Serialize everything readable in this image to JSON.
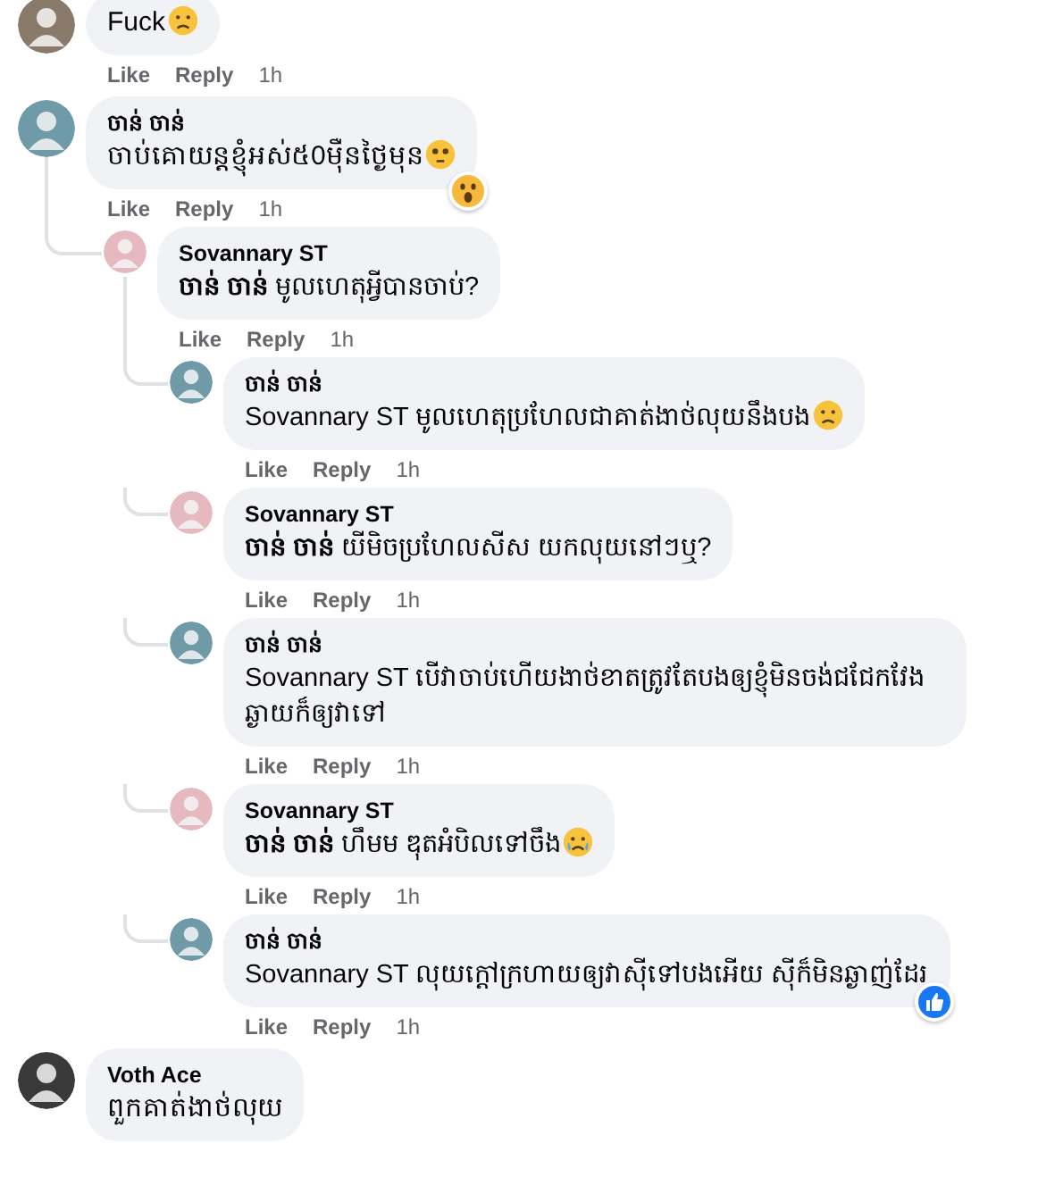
{
  "comments": [
    {
      "color": "#8a7a6a",
      "text": "Fuck",
      "emoji": {
        "kind": "sad"
      },
      "actions": [
        "Like",
        "Reply"
      ],
      "time": "1h"
    },
    {
      "author": "ចាន់ ចាន់",
      "color": "#6f9aa8",
      "text": "ចាប់គោយន្តខ្ញុំអស់៥0ម៉ឺនថ្ងៃមុន",
      "emoji": {
        "kind": "flushed"
      },
      "reaction": {
        "kind": "wow"
      },
      "actions": [
        "Like",
        "Reply"
      ],
      "time": "1h",
      "children": [
        {
          "author": "Sovannary ST",
          "color": "#e6b8c0",
          "text": "**ចាន់ ចាន់** មូលហេតុអ្វីបានចាប់?",
          "actions": [
            "Like",
            "Reply"
          ],
          "time": "1h",
          "children": [
            {
              "author": "ចាន់ ចាន់",
              "color": "#6f9aa8",
              "text": "Sovannary ST មូលហេតុប្រហែលជាគាត់ងាថ់លុយនឹងបង",
              "emoji": {
                "kind": "sad"
              },
              "actions": [
                "Like",
                "Reply"
              ],
              "time": "1h"
            },
            {
              "author": "Sovannary ST",
              "color": "#e6b8c0",
              "text": "**ចាន់ ចាន់** យីមិចប្រហែលសីស យកលុយនៅៗឬ?",
              "actions": [
                "Like",
                "Reply"
              ],
              "time": "1h"
            },
            {
              "author": "ចាន់ ចាន់",
              "color": "#6f9aa8",
              "text": "Sovannary ST បើវាចាប់ហើយងាថ់ខាតត្រូវតែបងឲ្យខ្ញុំមិនចង់ជជែកវែងឆ្ងាយក៏ឲ្យវាទៅ",
              "actions": [
                "Like",
                "Reply"
              ],
              "time": "1h"
            },
            {
              "author": "Sovannary ST",
              "color": "#e6b8c0",
              "text": "**ចាន់ ចាន់** ហឹមម ឌុតអំបិលទៅចឹង",
              "emoji": {
                "kind": "crying"
              },
              "actions": [
                "Like",
                "Reply"
              ],
              "time": "1h"
            },
            {
              "author": "ចាន់ ចាន់",
              "color": "#6f9aa8",
              "text": "Sovannary ST លុយក្ដៅក្រហាយឲ្យវាស៊ីទៅបងអើយ ស៊ីក៏មិនឆ្ងាញ់ដែរ",
              "reaction": {
                "kind": "like"
              },
              "actions": [
                "Like",
                "Reply"
              ],
              "time": "1h"
            }
          ]
        }
      ]
    },
    {
      "author": "Voth Ace",
      "color": "#3a3a3a",
      "text": "ពួកគាត់ងាថ់លុយ"
    }
  ]
}
